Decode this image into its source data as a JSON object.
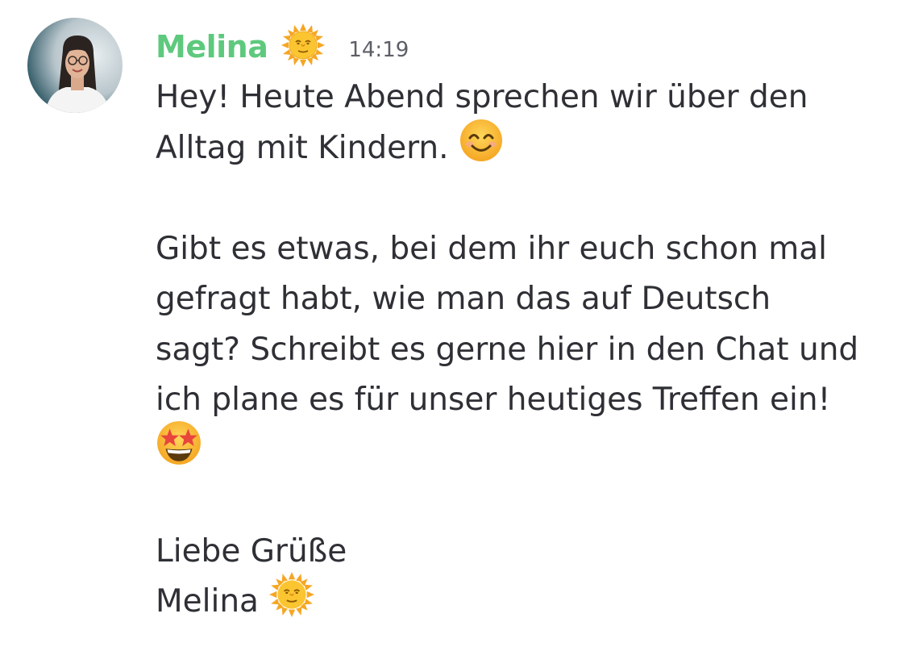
{
  "message": {
    "author": "Melina",
    "author_color": "#5ec97d",
    "author_badge_icon": "sun-with-face-emoji",
    "timestamp": "14:19",
    "lines": [
      "Hey! Heute Abend sprechen wir über den",
      "Alltag mit Kindern.",
      "",
      "Gibt es etwas, bei dem ihr euch schon mal",
      "gefragt habt, wie man das auf Deutsch",
      "sagt? Schreibt es gerne hier in den Chat und",
      "ich plane es für unser heutiges Treffen ein!",
      "",
      "",
      "Liebe Grüße",
      "Melina"
    ],
    "line_emojis": {
      "1": "smiling-face-with-smiling-eyes-emoji",
      "6": "star-struck-emoji",
      "10": "sun-with-face-emoji"
    }
  }
}
